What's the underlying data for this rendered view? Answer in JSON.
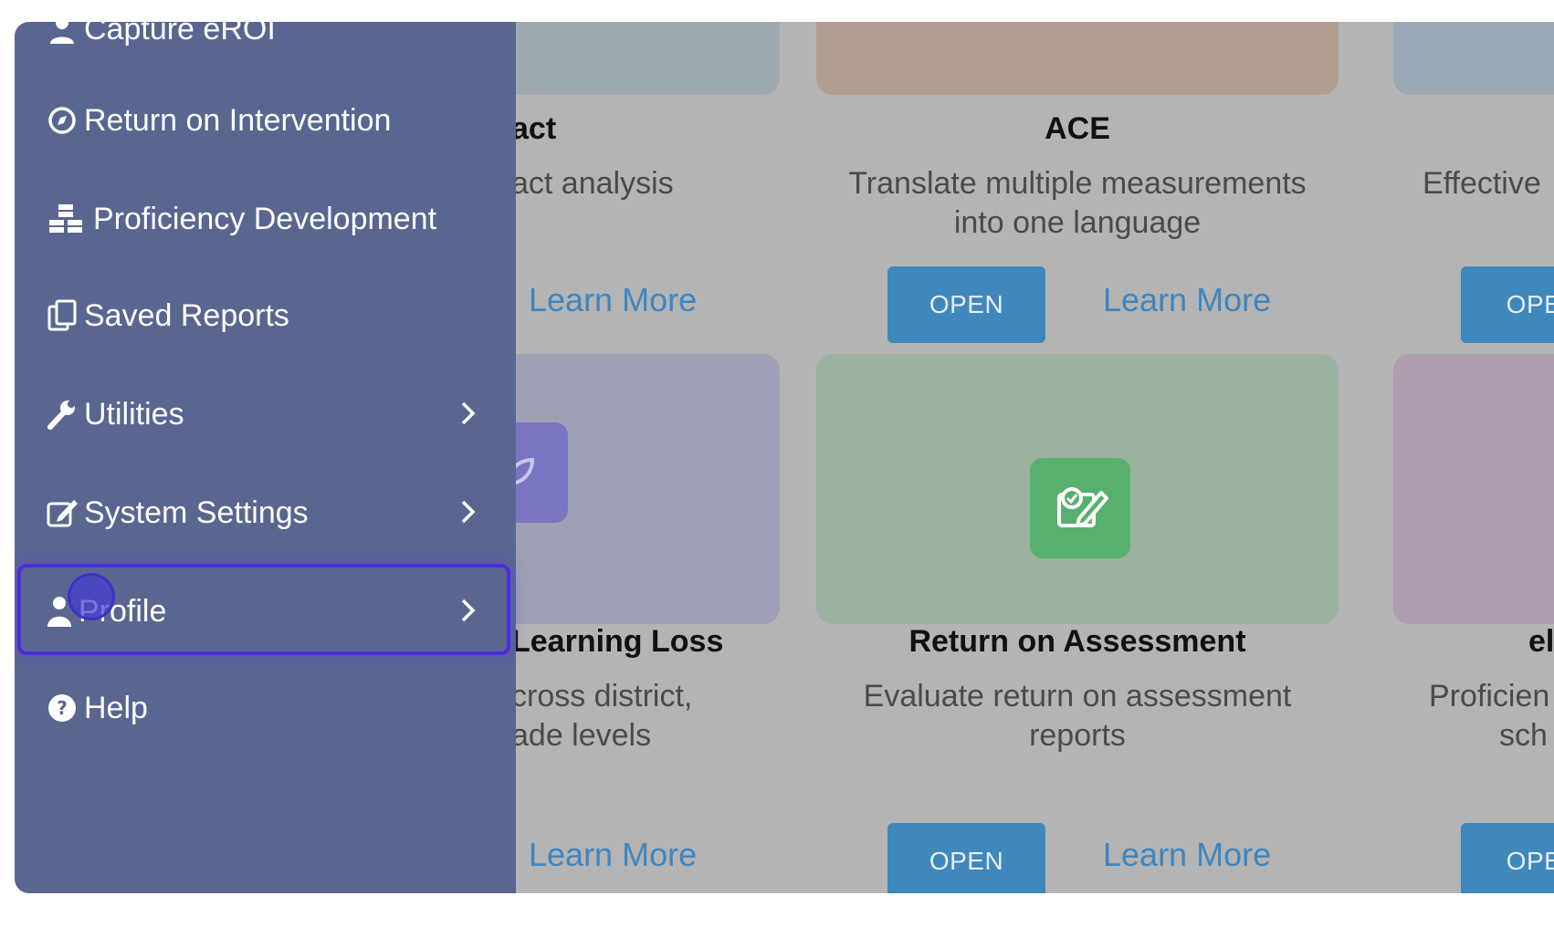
{
  "sidebar": {
    "items": [
      {
        "label": "Capture eROI",
        "icon": "user-tie-icon"
      },
      {
        "label": "Return on Intervention",
        "icon": "compass-icon"
      },
      {
        "label": "Proficiency Development",
        "icon": "cubes-icon"
      },
      {
        "label": "Saved Reports",
        "icon": "copy-icon"
      },
      {
        "label": "Utilities",
        "icon": "wrench-icon"
      },
      {
        "label": "System Settings",
        "icon": "edit-icon"
      },
      {
        "label": "Profile",
        "icon": "user-icon"
      },
      {
        "label": "Help",
        "icon": "question-circle-icon"
      }
    ]
  },
  "cards": {
    "impact": {
      "title_partial": "act",
      "desc_partial": "act analysis",
      "learn_more": "Learn More"
    },
    "ace": {
      "title": "ACE",
      "desc_line1": "Translate multiple measurements",
      "desc_line2": "into one language",
      "open": "OPEN",
      "learn_more": "Learn More"
    },
    "effective": {
      "desc_partial": "Effective",
      "open_partial": "OPE"
    },
    "learning_loss": {
      "title_partial": "Learning Loss",
      "desc_line1_partial": "cross district,",
      "desc_line2_partial": "ade levels",
      "learn_more": "Learn More"
    },
    "roa": {
      "title": "Return on Assessment",
      "desc_line1": "Evaluate return on assessment",
      "desc_line2": "reports",
      "open": "OPEN",
      "learn_more": "Learn More"
    },
    "ep": {
      "title_partial": "el",
      "desc_line1_partial": "Proficien",
      "desc_line2_partial": "sch",
      "open_partial": "OPE"
    }
  },
  "colors": {
    "sidebar_bg": "#596690",
    "open_button": "#3f88bd",
    "link": "#3e86c0",
    "highlight": "#4c2ce0"
  }
}
